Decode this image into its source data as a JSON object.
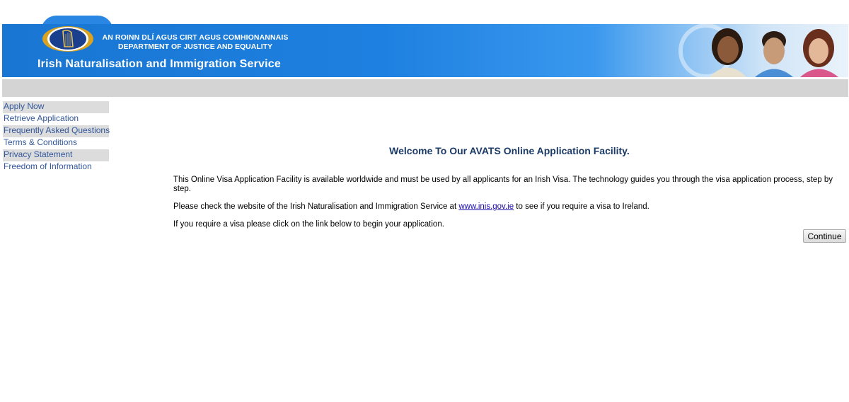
{
  "header": {
    "dept_irish": "AN ROINN DLÍ AGUS CIRT AGUS COMHIONANNAIS",
    "dept_english": "DEPARTMENT OF JUSTICE AND EQUALITY",
    "service_title": "Irish Naturalisation and Immigration Service",
    "brand_color": "#1e80e0"
  },
  "sidebar": {
    "items": [
      {
        "label": "Apply Now"
      },
      {
        "label": "Retrieve Application"
      },
      {
        "label": "Frequently Asked Questions"
      },
      {
        "label": "Terms & Conditions"
      },
      {
        "label": "Privacy Statement"
      },
      {
        "label": "Freedom of Information"
      }
    ]
  },
  "main": {
    "heading": "Welcome To Our AVATS Online Application Facility.",
    "para1": "This Online Visa Application Facility is available worldwide and must be used by all applicants for an Irish Visa. The technology guides you through the visa application process, step by step.",
    "para2_before": "Please check the website of the Irish Naturalisation and Immigration Service at ",
    "para2_link": "www.inis.gov.ie",
    "para2_after": " to see if you require a visa to Ireland.",
    "para3": "If you require a visa please click on the link below to begin your application.",
    "continue_label": "Continue"
  }
}
